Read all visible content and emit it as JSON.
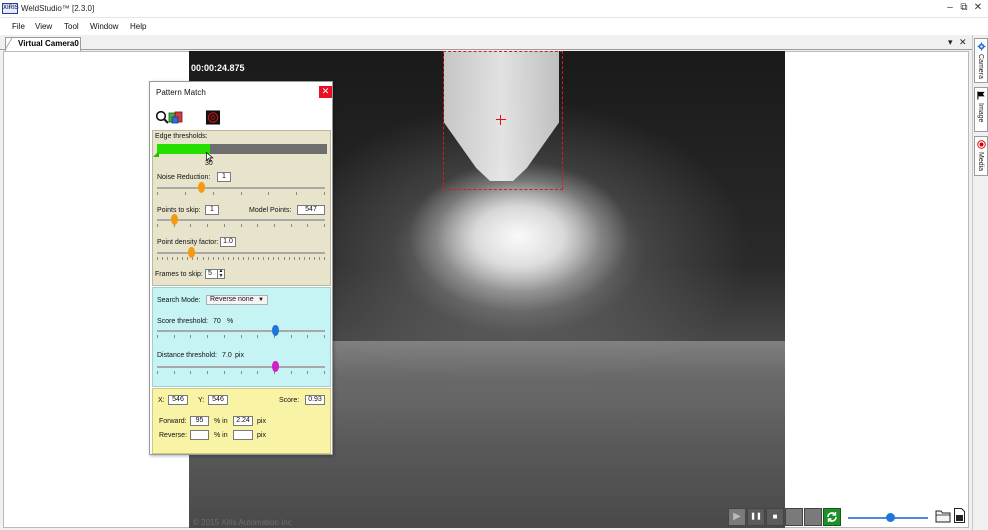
{
  "window": {
    "title": "WeldStudio™ [2.3.0]",
    "logo_text": "XIRIS",
    "minimize": "–",
    "restore": "⧉",
    "close": "✕"
  },
  "menu": [
    "File",
    "View",
    "Tool",
    "Window",
    "Help"
  ],
  "tabs": {
    "active": "Virtual Camera0",
    "dropdown": "▾",
    "close": "✕"
  },
  "video": {
    "timestamp": "00:00:24.875",
    "copyright": "© 2015 Xiris Automation Inc"
  },
  "side_panels": [
    {
      "label": "Camera",
      "icon": "gear-icon"
    },
    {
      "label": "Image",
      "icon": "flag-icon"
    },
    {
      "label": "Media",
      "icon": "record-icon"
    }
  ],
  "pattern_match": {
    "title": "Pattern Match",
    "close": "✕",
    "edge": {
      "label": "Edge thresholds:",
      "bar_fill": 0.31,
      "bar_value": "30",
      "noise_label": "Noise Reduction:",
      "noise_value": "1",
      "noise_level": 0.26,
      "skip_label": "Points to skip:",
      "skip_value": "1",
      "model_label": "Model Points:",
      "model_value": "547",
      "skip_level": 0.1,
      "density_label": "Point density factor:",
      "density_value": "1.0",
      "density_level": 0.2,
      "frames_label": "Frames to skip:",
      "frames_value": "5"
    },
    "search": {
      "mode_label": "Search Mode:",
      "mode_value": "Reverse none",
      "score_label": "Score threshold:",
      "score_value": "70",
      "score_unit": "%",
      "score_level": 0.7,
      "distance_label": "Distance threshold:",
      "distance_value": "7.0",
      "distance_unit": "pix",
      "distance_level": 0.7
    },
    "result": {
      "x_label": "X:",
      "x_value": "546",
      "y_label": "Y:",
      "y_value": "546",
      "score_label": "Score:",
      "score_value": "0.93",
      "forward_label": "Forward:",
      "forward_pct": "95",
      "forward_in": "% in",
      "forward_pix": "2.24",
      "reverse_label": "Reverse:",
      "reverse_pct": "",
      "reverse_in": "% in",
      "reverse_pix": "",
      "pix_unit": "pix"
    }
  },
  "player": {
    "play": "▶",
    "pause": "❚❚",
    "stop": "■",
    "zoom_level": 0.52
  },
  "colors": {
    "edge_green": "#23e000",
    "search_cyan": "#c6f4f4",
    "result_yellow": "#f9f3a6",
    "slider_orange": "#f59a12",
    "slider_blue": "#1f76d6",
    "slider_magenta": "#d020c8",
    "search_rect_red": "#d81b1b"
  }
}
